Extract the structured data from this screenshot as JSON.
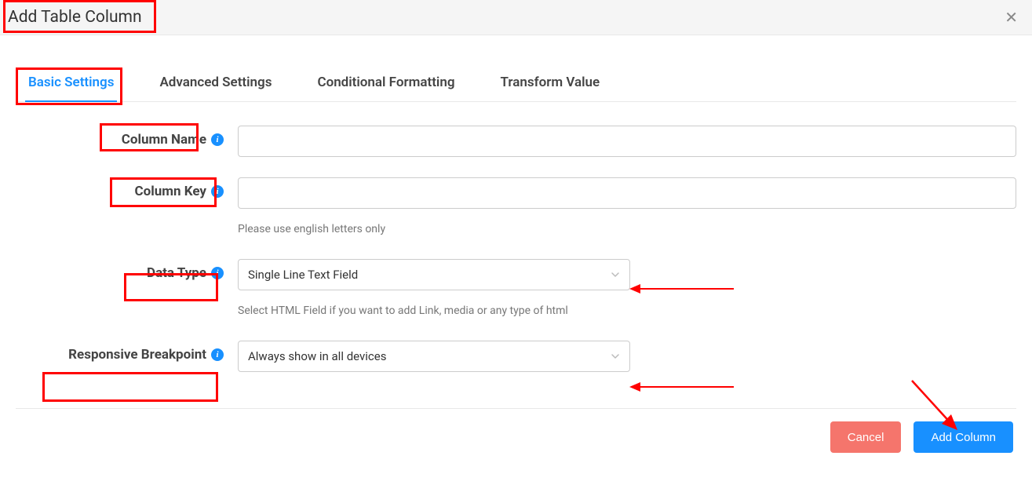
{
  "header": {
    "title": "Add Table Column"
  },
  "tabs": [
    {
      "label": "Basic Settings",
      "active": true
    },
    {
      "label": "Advanced Settings",
      "active": false
    },
    {
      "label": "Conditional Formatting",
      "active": false
    },
    {
      "label": "Transform Value",
      "active": false
    }
  ],
  "form": {
    "column_name": {
      "label": "Column Name",
      "value": ""
    },
    "column_key": {
      "label": "Column Key",
      "value": "",
      "help": "Please use english letters only"
    },
    "data_type": {
      "label": "Data Type",
      "value": "Single Line Text Field",
      "help": "Select HTML Field if you want to add Link, media or any type of html"
    },
    "responsive": {
      "label": "Responsive Breakpoint",
      "value": "Always show in all devices"
    }
  },
  "footer": {
    "cancel": "Cancel",
    "submit": "Add Column"
  }
}
